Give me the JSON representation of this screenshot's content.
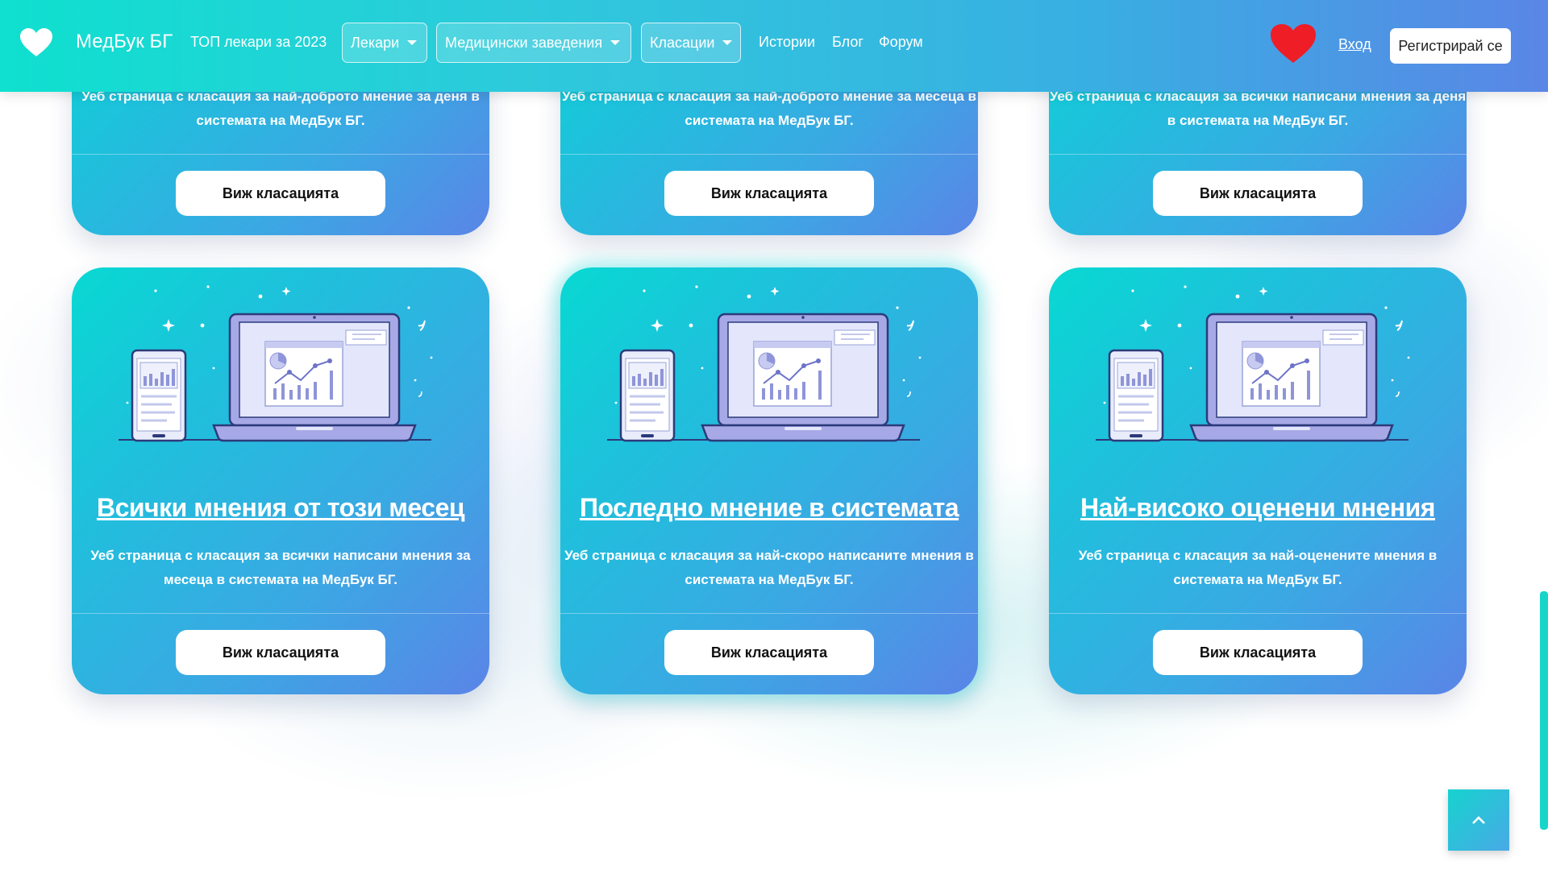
{
  "nav": {
    "brand": "МедБук БГ",
    "top_doctors": "ТОП лекари за 2023",
    "doctors_dropdown": "Лекари",
    "facilities_dropdown": "Медицински заведения",
    "rankings_dropdown": "Класации",
    "stories": "Истории",
    "blog": "Блог",
    "forum": "Форум",
    "login": "Вход",
    "register": "Регистрирай се"
  },
  "colors": {
    "nav_gradient_start": "#0fe0cf",
    "nav_gradient_end": "#5a86e6",
    "card_gradient_start": "#08d9d2",
    "card_gradient_end": "#5a85e7",
    "heart_red": "#ef1d26"
  },
  "top_cards": [
    {
      "desc": "Уеб страница с класация за най-доброто мнение за деня в системата на МедБук БГ.",
      "button": "Виж класацията"
    },
    {
      "desc": "Уеб страница с класация за най-доброто мнение за месеца в системата на МедБук БГ.",
      "button": "Виж класацията"
    },
    {
      "desc": "Уеб страница с класация за всички написани мнения за деня в системата на МедБук БГ.",
      "button": "Виж класацията"
    }
  ],
  "bottom_cards": [
    {
      "title": "Всички мнения от този месец",
      "desc": "Уеб страница с класация за всички написани мнения за месеца в системата на МедБук БГ.",
      "button": "Виж класацията"
    },
    {
      "title": "Последно мнение в системата",
      "desc": "Уеб страница с класация за най-скоро написаните мнения в системата на МедБук БГ.",
      "button": "Виж класацията"
    },
    {
      "title": "Най-високо оценени мнения",
      "desc": "Уеб страница с класация за най-оценените мнения в системата на МедБук БГ.",
      "button": "Виж класацията"
    }
  ],
  "icons": {
    "logo": "heart-icon",
    "favorites": "red-heart-icon",
    "back_to_top": "chevron-up-icon",
    "illustration": "laptop-phone-analytics-icon"
  }
}
